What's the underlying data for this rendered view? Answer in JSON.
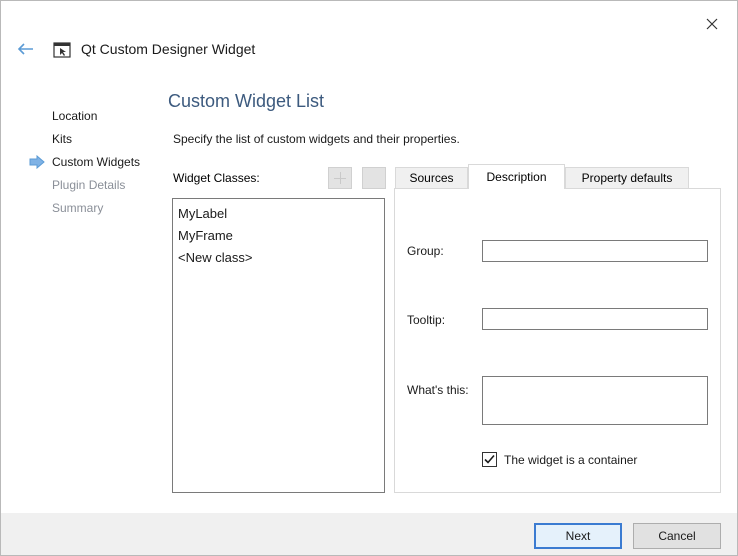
{
  "window": {
    "title": "Qt Custom Designer Widget"
  },
  "steps": [
    {
      "label": "Location",
      "state": "done"
    },
    {
      "label": "Kits",
      "state": "done"
    },
    {
      "label": "Custom Widgets",
      "state": "current"
    },
    {
      "label": "Plugin Details",
      "state": "pending"
    },
    {
      "label": "Summary",
      "state": "pending"
    }
  ],
  "page": {
    "title": "Custom Widget List",
    "subtitle": "Specify the list of custom widgets and their properties."
  },
  "widget_classes": {
    "label": "Widget Classes:",
    "items": [
      "MyLabel",
      "MyFrame",
      "<New class>"
    ]
  },
  "tabs": {
    "sources": "Sources",
    "description": "Description",
    "property_defaults": "Property defaults",
    "active": "Description"
  },
  "description": {
    "group_label": "Group:",
    "group_value": "",
    "tooltip_label": "Tooltip:",
    "tooltip_value": "",
    "whats_this_label": "What's this:",
    "whats_this_value": "",
    "container_label": "The widget is a container",
    "container_checked": true
  },
  "buttons": {
    "next": "Next",
    "cancel": "Cancel"
  },
  "colors": {
    "title_blue": "#3c5a7e",
    "step_arrow": "#5b9bd5",
    "dim_text": "#8a8f98",
    "default_button_border": "#3b7bd1"
  }
}
